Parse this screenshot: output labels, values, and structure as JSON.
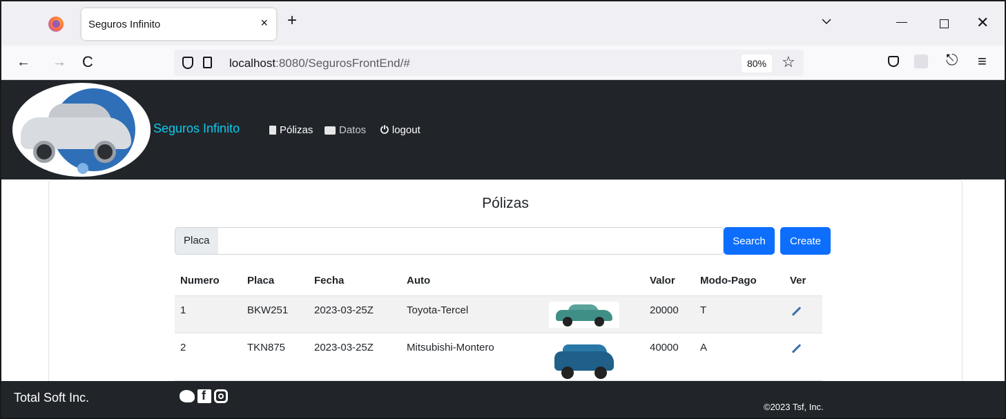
{
  "browser": {
    "tab_title": "Seguros Infinito",
    "tab_close": "×",
    "new_tab": "+",
    "url_host": "localhost",
    "url_path": ":8080/SegurosFrontEnd/#",
    "zoom": "80%",
    "back": "←",
    "forward": "→",
    "reload": "C",
    "star": "☆",
    "share": "⎋",
    "menu": "≡",
    "close": "✕"
  },
  "header": {
    "brand": "Seguros Infinito",
    "nav": [
      {
        "label": "Pólizas"
      },
      {
        "label": "Datos"
      },
      {
        "label": "logout"
      }
    ]
  },
  "main": {
    "title": "Pólizas",
    "search": {
      "label": "Placa",
      "value": "",
      "placeholder": "",
      "search_button": "Search",
      "create_button": "Create"
    },
    "table": {
      "columns": [
        "Numero",
        "Placa",
        "Fecha",
        "Auto",
        "",
        "Valor",
        "Modo-Pago",
        "Ver"
      ],
      "rows": [
        {
          "numero": "1",
          "placa": "BKW251",
          "fecha": "2023-03-25Z",
          "auto": "Toyota-Tercel",
          "valor": "20000",
          "modo_pago": "T"
        },
        {
          "numero": "2",
          "placa": "TKN875",
          "fecha": "2023-03-25Z",
          "auto": "Mitsubishi-Montero",
          "valor": "40000",
          "modo_pago": "A"
        }
      ]
    }
  },
  "footer": {
    "brand": "Total Soft Inc.",
    "copyright": "©2023 Tsf, Inc."
  },
  "colors": {
    "header_bg": "#212529",
    "brand": "#0dcaf0",
    "primary": "#0d6efd"
  }
}
